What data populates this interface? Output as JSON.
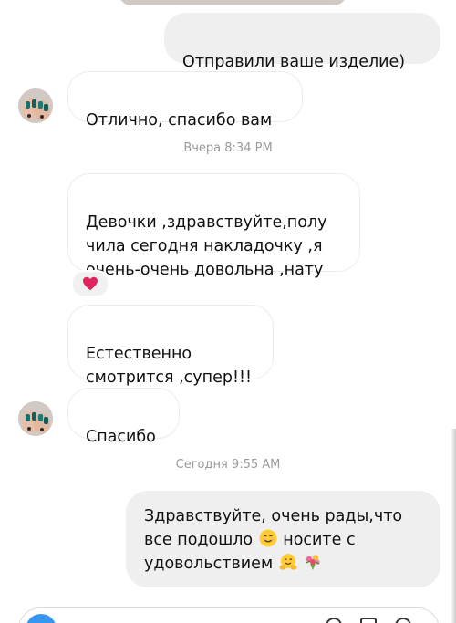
{
  "messages": {
    "m1": {
      "text": "Отправили ваше изделие)"
    },
    "m2": {
      "text": "Отлично, спасибо вам"
    },
    "m3": {
      "text": "Девочки ,здравствуйте,полу\nчила сегодня накладочку ,я\nочень-очень довольна ,нату"
    },
    "m4": {
      "text": "Естественно\nсмотрится ,супер!!!"
    },
    "m5": {
      "text": "Спасибо"
    },
    "m6": {
      "line1": "Здравствуйте, очень рады,что",
      "line2a": "все подошло",
      "line2b": "носите с",
      "line3": "удовольствием"
    }
  },
  "timestamps": {
    "yesterday": "Вчера 8:34 PM",
    "today": "Сегодня 9:55 AM"
  },
  "icons": {
    "reaction": "heart-icon",
    "smile": "smiling-face-emoji",
    "hug": "hugging-face-emoji",
    "bouquet": "bouquet-emoji",
    "camera": "camera-icon"
  },
  "colors": {
    "outgoing_bubble": "#efefef",
    "incoming_bubble_border": "#ececec",
    "timestamp": "#9a9a9a",
    "heart": "#e0245e",
    "camera_button": "#3797f0"
  }
}
